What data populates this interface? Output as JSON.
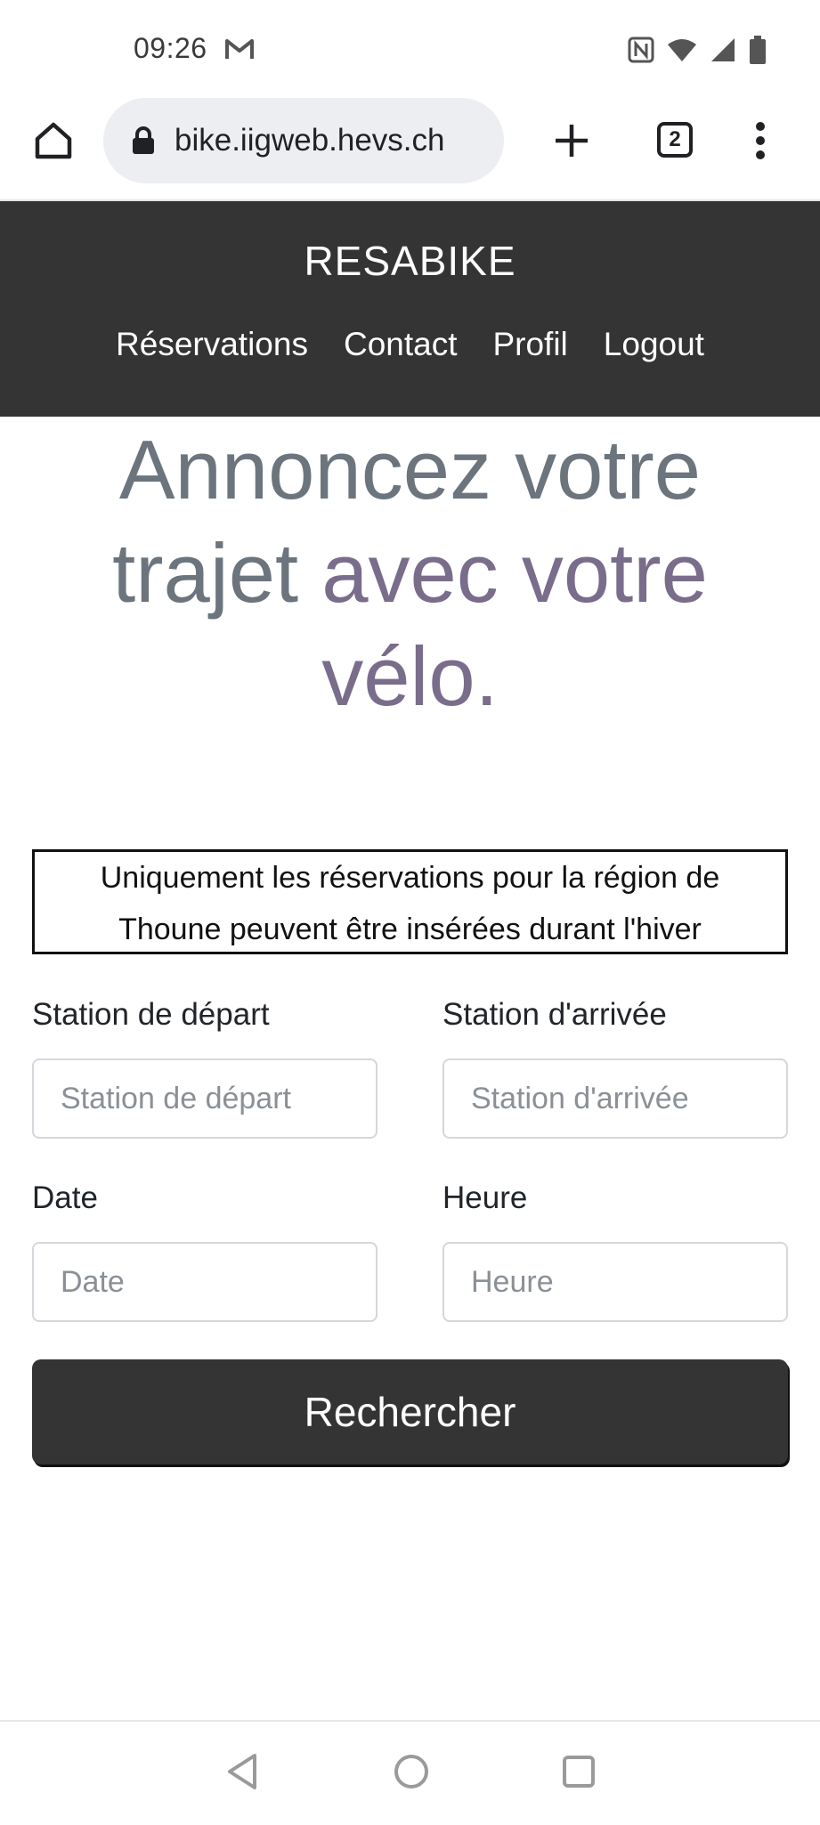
{
  "status_bar": {
    "time": "09:26",
    "icons": [
      "gmail-icon",
      "nfc-icon",
      "wifi-icon",
      "signal-icon",
      "battery-icon"
    ]
  },
  "browser": {
    "url": "bike.iigweb.hevs.ch",
    "tab_count": "2",
    "icons": [
      "home-icon",
      "lock-icon",
      "plus-icon",
      "tabs-icon",
      "more-vert-icon"
    ]
  },
  "site": {
    "brand": "RESABIKE",
    "nav": [
      "Réservations",
      "Contact",
      "Profil",
      "Logout"
    ]
  },
  "headline": {
    "part1": "Annoncez votre trajet ",
    "part2": "avec votre vélo.",
    "colors": {
      "part1": "#6c757d",
      "part2": "#7a6d8b"
    }
  },
  "notice": {
    "line1": "Uniquement les réservations pour la région de",
    "line2": "Thoune peuvent être insérées durant l'hiver"
  },
  "form": {
    "departure": {
      "label": "Station de départ",
      "placeholder": "Station de départ",
      "value": ""
    },
    "arrival": {
      "label": "Station d'arrivée",
      "placeholder": "Station d'arrivée",
      "value": ""
    },
    "date": {
      "label": "Date",
      "placeholder": "Date",
      "value": ""
    },
    "time": {
      "label": "Heure",
      "placeholder": "Heure",
      "value": ""
    },
    "submit_label": "Rechercher"
  },
  "colors": {
    "nav_background": "#343434",
    "button_background": "#343434",
    "url_pill": "#eceef1"
  },
  "android_nav": {
    "icons": [
      "back-icon",
      "home-circle-icon",
      "recents-icon"
    ]
  }
}
